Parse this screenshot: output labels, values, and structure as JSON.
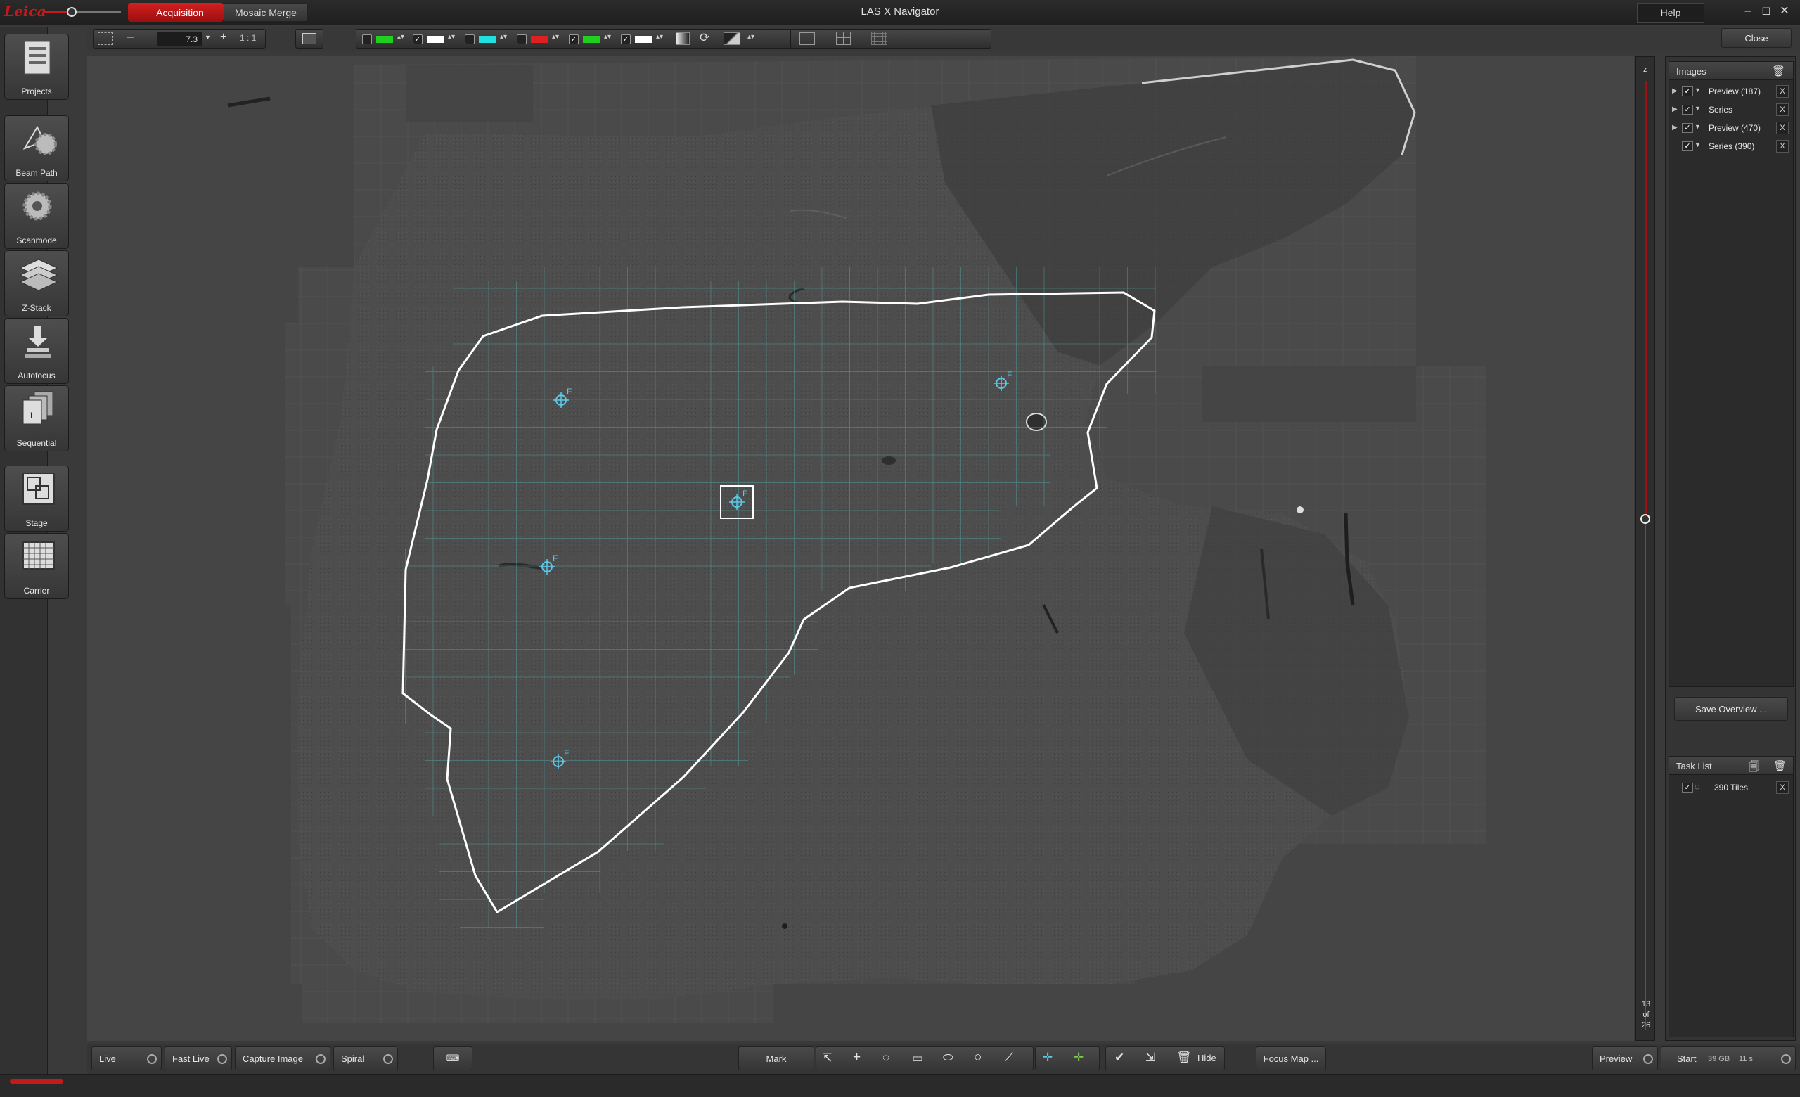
{
  "app": {
    "title": "LAS X Navigator",
    "logo": "Leica",
    "help_label": "Help",
    "close_label": "Close",
    "window_controls": [
      "minimize-icon",
      "maximize-icon",
      "close-icon"
    ]
  },
  "tabs": [
    {
      "label": "Acquisition",
      "active": true
    },
    {
      "label": "Mosaic Merge",
      "active": false
    }
  ],
  "toolbar": {
    "zoom_value": "7.3",
    "zoom_minus": "–",
    "zoom_plus": "+",
    "zoom_ratio": "1 : 1",
    "channels": [
      {
        "checked": false,
        "color": "#20d020"
      },
      {
        "checked": true,
        "color": "#ffffff"
      },
      {
        "checked": false,
        "color": "#20e0e0"
      },
      {
        "checked": false,
        "color": "#e02020"
      },
      {
        "checked": true,
        "color": "#20d020"
      },
      {
        "checked": true,
        "color": "#ffffff"
      }
    ]
  },
  "sidebar": {
    "items": [
      {
        "label": "Projects",
        "icon": "projects-icon"
      },
      {
        "label": "Beam Path",
        "icon": "beam-path-icon"
      },
      {
        "label": "Scanmode",
        "icon": "scanmode-icon"
      },
      {
        "label": "Z-Stack",
        "icon": "z-stack-icon"
      },
      {
        "label": "Autofocus",
        "icon": "autofocus-icon"
      },
      {
        "label": "Sequential",
        "icon": "sequential-icon"
      },
      {
        "label": "Stage",
        "icon": "stage-icon"
      },
      {
        "label": "Carrier",
        "icon": "carrier-icon"
      }
    ]
  },
  "viewport": {
    "focus_point_label": "F"
  },
  "z_bar": {
    "label": "z",
    "current": "13",
    "of": "of",
    "total": "26"
  },
  "images_panel": {
    "title": "Images",
    "items": [
      {
        "name": "Preview (187)",
        "expandable": true
      },
      {
        "name": "Series",
        "expandable": true
      },
      {
        "name": "Preview (470)",
        "expandable": true
      },
      {
        "name": "Series (390)",
        "expandable": false
      }
    ],
    "remove_label": "X"
  },
  "save_overview_label": "Save Overview ...",
  "task_list": {
    "title": "Task List",
    "items": [
      {
        "name": "390 Tiles"
      }
    ],
    "remove_label": "X"
  },
  "bottom": {
    "live": "Live",
    "fast_live": "Fast Live",
    "capture_image": "Capture Image",
    "spiral": "Spiral",
    "mark": "Mark",
    "hide": "Hide",
    "focus_map": "Focus Map ...",
    "preview": "Preview",
    "start": "Start",
    "start_size": "39 GB",
    "start_time": "11 s"
  },
  "colors": {
    "accent": "#c41a1a",
    "tile_grid": "#4fb3b3",
    "focus_marker": "#5cc8e8"
  }
}
